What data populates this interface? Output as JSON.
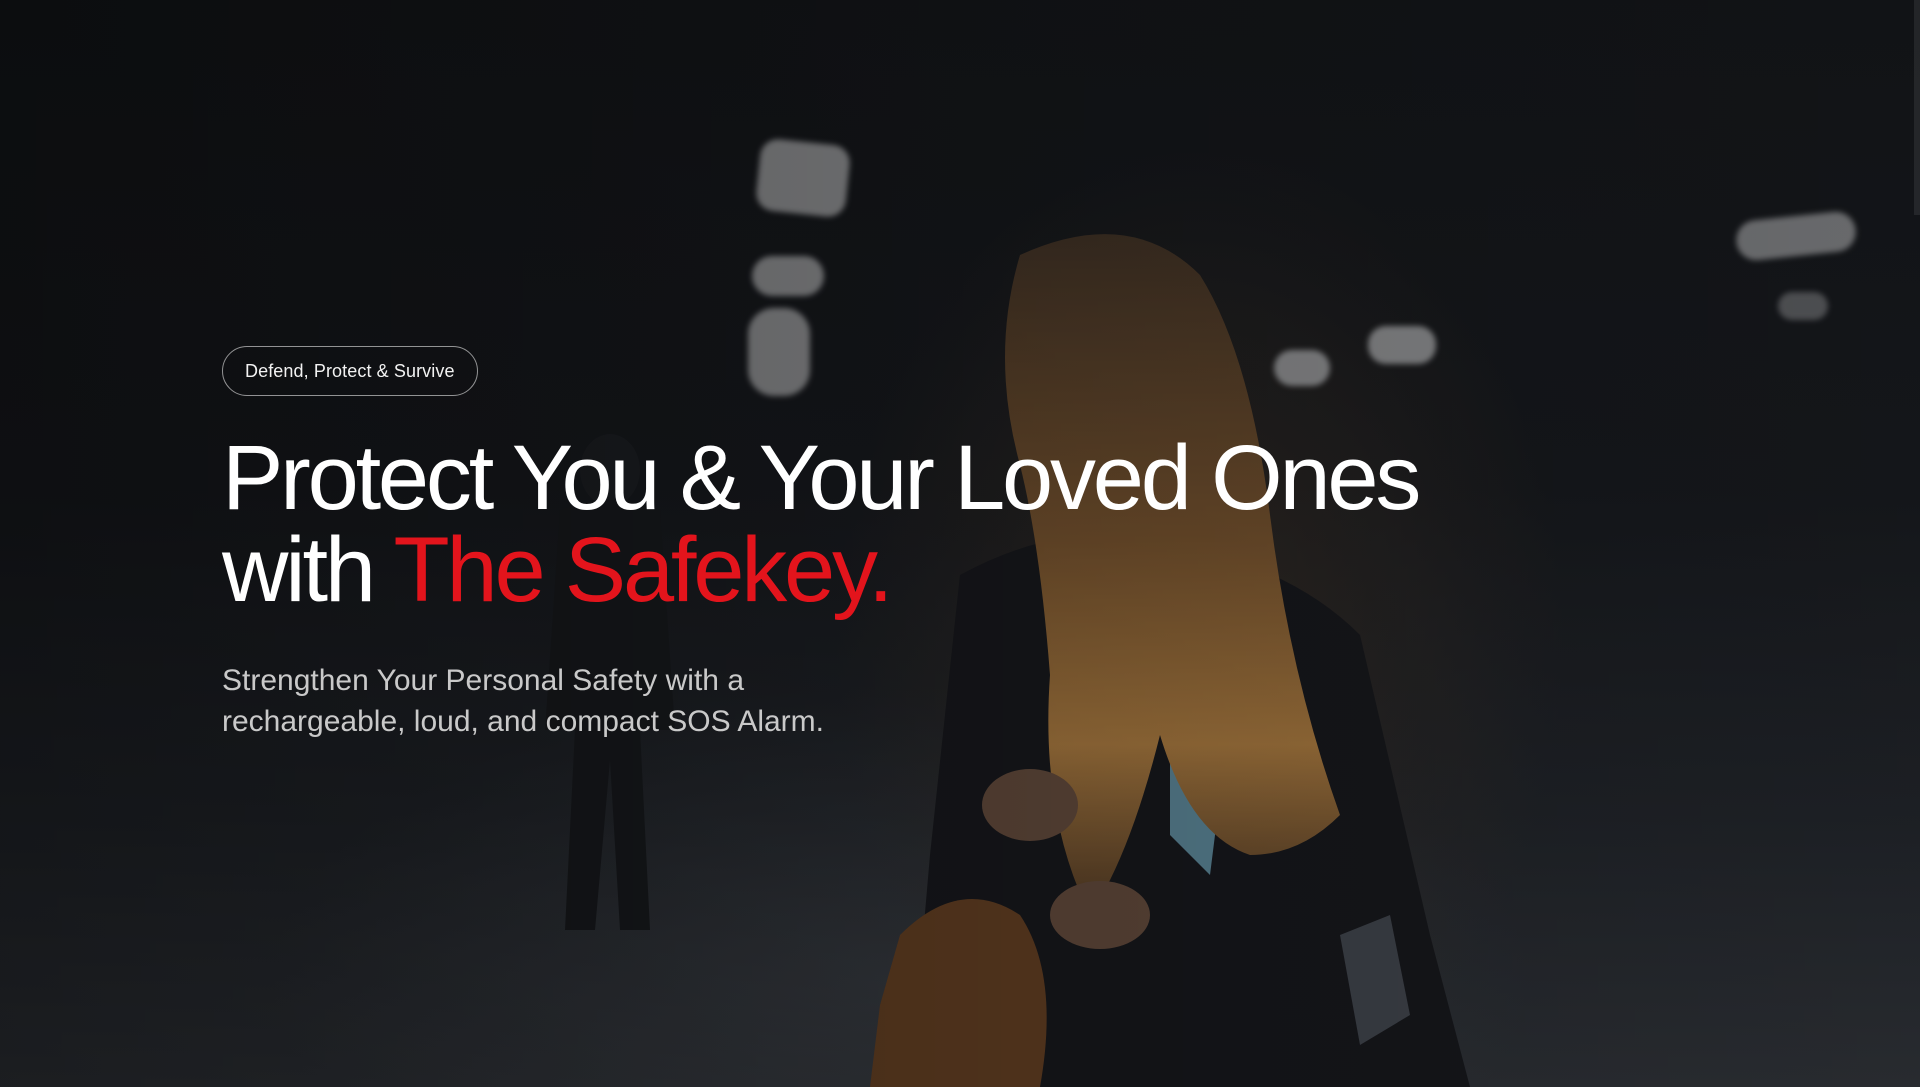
{
  "hero": {
    "badge": "Defend, Protect & Survive",
    "headline_line1": "Protect You & Your Loved Ones",
    "headline_prefix": "with ",
    "headline_accent": "The Safekey.",
    "subheadline_line1": "Strengthen Your Personal Safety with a",
    "subheadline_line2": "rechargeable, loud, and compact SOS Alarm."
  },
  "colors": {
    "background": "#121417",
    "text": "#ffffff",
    "accent": "#e3141c",
    "subtext": "#c9c9c9"
  },
  "background_image": "woman-walking-in-dark-parking-garage"
}
